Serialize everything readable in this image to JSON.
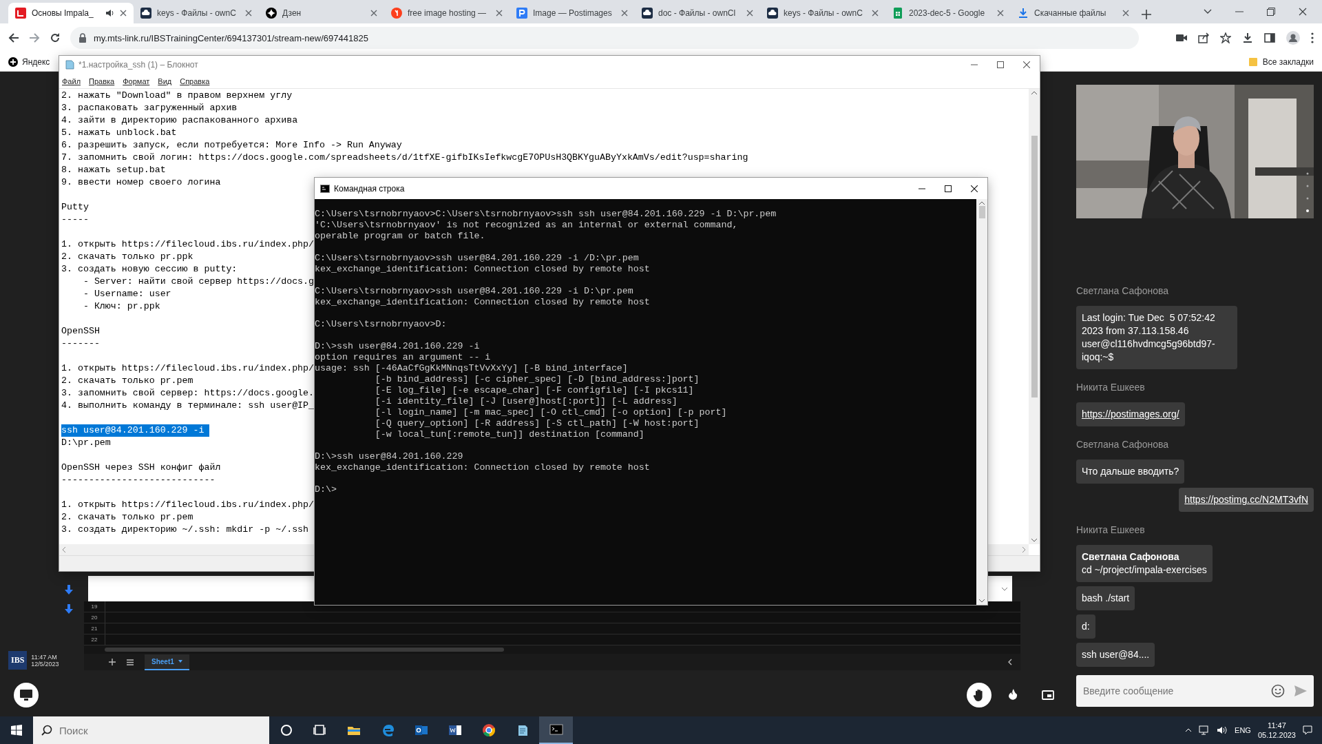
{
  "browser": {
    "tabs": [
      {
        "title": "Основы Impala_",
        "kind": "ibs",
        "selected": true,
        "audio": true
      },
      {
        "title": "keys - Файлы - ownC",
        "kind": "owncloud",
        "selected": false,
        "audio": false
      },
      {
        "title": "Дзен",
        "kind": "dzen",
        "selected": false,
        "audio": false
      },
      {
        "title": "free image hosting —",
        "kind": "yandex",
        "selected": false,
        "audio": false
      },
      {
        "title": "Image — Postimages",
        "kind": "postimages",
        "selected": false,
        "audio": false
      },
      {
        "title": "doc - Файлы - ownCl",
        "kind": "owncloud",
        "selected": false,
        "audio": false
      },
      {
        "title": "keys - Файлы - ownC",
        "kind": "owncloud",
        "selected": false,
        "audio": false
      },
      {
        "title": "2023-dec-5 - Google",
        "kind": "sheets",
        "selected": false,
        "audio": false
      },
      {
        "title": "Скачанные файлы",
        "kind": "download",
        "selected": false,
        "audio": false
      }
    ],
    "address": "my.mts-link.ru/IBSTrainingCenter/694137301/stream-new/697441825",
    "bookmarks": [
      "Яндекс"
    ],
    "all_bookmarks": "Все закладки"
  },
  "shared_screen": {
    "logo": "IBS",
    "time": "11:47 AM",
    "date": "12/5/2023",
    "spreadsheet": {
      "rows": [
        "19",
        "20",
        "21",
        "22"
      ],
      "sheet_tabs": [
        {
          "label": "Sheet1",
          "selected": true
        }
      ]
    }
  },
  "notepad": {
    "title": "*1.настройка_ssh (1) – Блокнот",
    "menu": [
      "Файл",
      "Правка",
      "Формат",
      "Вид",
      "Справка"
    ],
    "blocks": [
      [
        {
          "text": "2. нажать \"Download\" в правом верхнем углу",
          "selected": false
        },
        {
          "text": "3. распаковать загруженный архив",
          "selected": false
        },
        {
          "text": "4. зайти в директорию распакованного архива",
          "selected": false
        },
        {
          "text": "5. нажать unblock.bat",
          "selected": false
        },
        {
          "text": "6. разрешить запуск, если потребуется: More Info -> Run Anyway",
          "selected": false
        },
        {
          "text": "7. запомнить свой логин: https://docs.google.com/spreadsheets/d/1tfXE-gifbIKsIefkwcgE7OPUsH3QBKYguAByYxkAmVs/edit?usp=sharing",
          "selected": false
        },
        {
          "text": "8. нажать setup.bat",
          "selected": false
        },
        {
          "text": "9. ввести номер своего логина",
          "selected": false
        }
      ],
      [
        {
          "text": "Putty",
          "selected": false
        },
        {
          "text": "-----",
          "selected": false
        }
      ],
      [
        {
          "text": "1. открыть https://filecloud.ibs.ru/index.php/",
          "selected": false
        },
        {
          "text": "2. скачать только pr.ppk",
          "selected": false
        },
        {
          "text": "3. создать новую сессию в putty:",
          "selected": false
        },
        {
          "text": "    - Server: найти свой сервер https://docs.g",
          "selected": false
        },
        {
          "text": "    - Username: user",
          "selected": false
        },
        {
          "text": "    - Ключ: pr.ppk",
          "selected": false
        }
      ],
      [
        {
          "text": "OpenSSH",
          "selected": false
        },
        {
          "text": "-------",
          "selected": false
        }
      ],
      [
        {
          "text": "1. открыть https://filecloud.ibs.ru/index.php/",
          "selected": false
        },
        {
          "text": "2. скачать только pr.pem",
          "selected": false
        },
        {
          "text": "3. запомнить свой сервер: https://docs.google.",
          "selected": false
        },
        {
          "text": "4. выполнить команду в терминале: ssh user@IP_",
          "selected": false
        }
      ],
      [
        {
          "text": "ssh user@84.201.160.229 -i ",
          "selected": true
        },
        {
          "text": "D:\\pr.pem",
          "selected": false
        }
      ],
      [
        {
          "text": "OpenSSH через SSH конфиг файл",
          "selected": false
        },
        {
          "text": "----------------------------",
          "selected": false
        }
      ],
      [
        {
          "text": "1. открыть https://filecloud.ibs.ru/index.php/",
          "selected": false
        },
        {
          "text": "2. скачать только pr.pem",
          "selected": false
        },
        {
          "text": "3. создать директорию ~/.ssh: mkdir -p ~/.ssh",
          "selected": false
        }
      ]
    ]
  },
  "cmd": {
    "title": "Командная строка",
    "blocks": [
      [
        "C:\\Users\\tsrnobrnyaov>C:\\Users\\tsrnobrnyaov>ssh ssh user@84.201.160.229 -i D:\\pr.pem",
        "'C:\\Users\\tsrnobrnyaov' is not recognized as an internal or external command,",
        "operable program or batch file."
      ],
      [
        "C:\\Users\\tsrnobrnyaov>ssh user@84.201.160.229 -i /D:\\pr.pem",
        "kex_exchange_identification: Connection closed by remote host"
      ],
      [
        "C:\\Users\\tsrnobrnyaov>ssh user@84.201.160.229 -i D:\\pr.pem",
        "kex_exchange_identification: Connection closed by remote host"
      ],
      [
        "C:\\Users\\tsrnobrnyaov>D:"
      ],
      [
        "D:\\>ssh user@84.201.160.229 -i",
        "option requires an argument -- i",
        "usage: ssh [-46AaCfGgKkMNnqsTtVvXxYy] [-B bind_interface]",
        "           [-b bind_address] [-c cipher_spec] [-D [bind_address:]port]",
        "           [-E log_file] [-e escape_char] [-F configfile] [-I pkcs11]",
        "           [-i identity_file] [-J [user@]host[:port]] [-L address]",
        "           [-l login_name] [-m mac_spec] [-O ctl_cmd] [-o option] [-p port]",
        "           [-Q query_option] [-R address] [-S ctl_path] [-W host:port]",
        "           [-w local_tun[:remote_tun]] destination [command]"
      ],
      [
        "D:\\>ssh user@84.201.160.229",
        "kex_exchange_identification: Connection closed by remote host"
      ],
      [
        "D:\\>"
      ]
    ]
  },
  "chat": {
    "messages": [
      {
        "author": "Светлана Сафонова",
        "bubbles": [
          {
            "kind": "text",
            "text": "Last login: Tue Dec  5 07:52:42 2023 from 37.113.158.46 user@cl116hvdmcg5g96btd97-iqoq:~$"
          }
        ]
      },
      {
        "author": "Никита Ешкеев",
        "bubbles": [
          {
            "kind": "link",
            "text": "https://postimages.org/"
          }
        ]
      },
      {
        "author": "Светлана Сафонова",
        "bubbles": [
          {
            "kind": "text",
            "text": "Что дальше вводить?"
          }
        ]
      },
      {
        "outgoing": true,
        "bubbles": [
          {
            "kind": "link",
            "text": "https://postimg.cc/N2MT3vfN"
          }
        ]
      },
      {
        "author": "Никита Ешкеев",
        "bubbles": [
          {
            "kind": "reply",
            "quote_author": "Светлана Сафонова",
            "text": "cd ~/project/impala-exercises"
          },
          {
            "kind": "text",
            "text": "bash ./start"
          },
          {
            "kind": "text",
            "text": "d:"
          },
          {
            "kind": "text",
            "text": "ssh user@84...."
          }
        ]
      }
    ],
    "input": {
      "placeholder": "Введите сообщение"
    }
  },
  "taskbar": {
    "search": {
      "placeholder": "Поиск"
    },
    "apps": [
      {
        "kind": "cortana",
        "active": false
      },
      {
        "kind": "taskview",
        "active": false
      },
      {
        "kind": "explorer",
        "active": false
      },
      {
        "kind": "edge",
        "active": false
      },
      {
        "kind": "outlook",
        "active": false
      },
      {
        "kind": "word",
        "active": false
      },
      {
        "kind": "chrome",
        "active": false
      },
      {
        "kind": "notepad",
        "active": false
      },
      {
        "kind": "cmd",
        "active": true
      }
    ],
    "language": "ENG",
    "time": "11:47",
    "date": "05.12.2023"
  }
}
